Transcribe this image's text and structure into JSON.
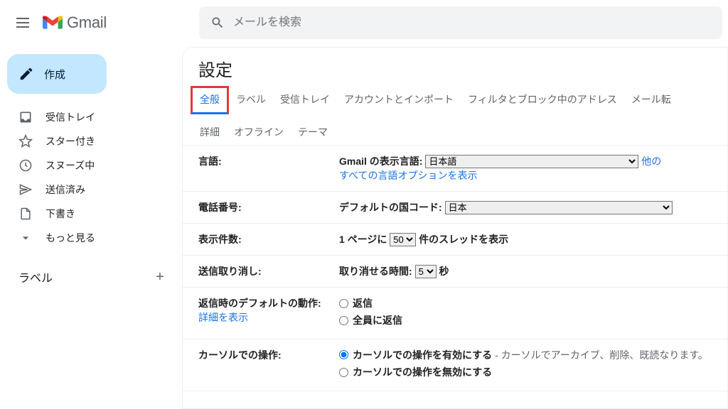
{
  "header": {
    "app_name": "Gmail",
    "search_placeholder": "メールを検索"
  },
  "compose_label": "作成",
  "sidebar_items": [
    "受信トレイ",
    "スター付き",
    "スヌーズ中",
    "送信済み",
    "下書き",
    "もっと見る"
  ],
  "labels_header": "ラベル",
  "settings_title": "設定",
  "tabs_row1": [
    "全般",
    "ラベル",
    "受信トレイ",
    "アカウントとインポート",
    "フィルタとブロック中のアドレス",
    "メール転"
  ],
  "tabs_row2": [
    "詳細",
    "オフライン",
    "テーマ"
  ],
  "active_tab": "全般",
  "rows": {
    "language": {
      "label": "言語:",
      "display_lang_label": "Gmail の表示言語:",
      "display_lang_value": "日本語",
      "other_link": "他の",
      "show_all_link": "すべての言語オプションを表示"
    },
    "phone": {
      "label": "電話番号:",
      "default_code_label": "デフォルトの国コード:",
      "default_code_value": "日本"
    },
    "page_size": {
      "label": "表示件数:",
      "prefix": "1 ページに",
      "value": "50",
      "suffix": "件のスレッドを表示"
    },
    "undo": {
      "label": "送信取り消し:",
      "prefix": "取り消せる時間:",
      "value": "5",
      "suffix": "秒"
    },
    "reply": {
      "label": "返信時のデフォルトの動作:",
      "detail_link": "詳細を表示",
      "opt1": "返信",
      "opt2": "全員に返信"
    },
    "hover": {
      "label": "カーソルでの操作:",
      "opt1_bold": "カーソルでの操作を有効にする",
      "opt1_rest": " - カーソルでアーカイブ、削除、既読なります。",
      "opt2": "カーソルでの操作を無効にする"
    }
  }
}
